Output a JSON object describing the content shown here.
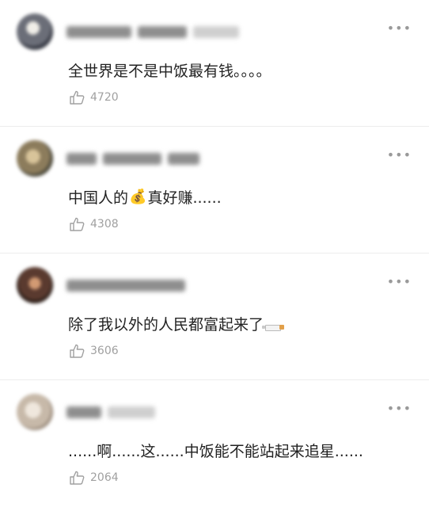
{
  "comments": [
    {
      "avatar_color": "#6b6e78",
      "text": "全世界是不是中饭最有钱。。。。",
      "likes": "4720",
      "emoji": ""
    },
    {
      "avatar_color": "#8c7c5c",
      "text": "中国人的",
      "emoji": "💰",
      "text_after": "真好赚......",
      "likes": "4308"
    },
    {
      "avatar_color": "#5a3a2f",
      "text": "除了我以外的人民都富起来了",
      "emoji": "cigarette",
      "likes": "3606"
    },
    {
      "avatar_color": "#c7b9a9",
      "text": "......啊......这......中饭能不能站起来追星......",
      "likes": "2064",
      "emoji": ""
    }
  ],
  "icons": {
    "more": "more-dots-icon",
    "like": "thumbs-up-icon"
  },
  "colors": {
    "muted": "#a0a0a0",
    "text": "#222222",
    "divider": "#ececec"
  }
}
